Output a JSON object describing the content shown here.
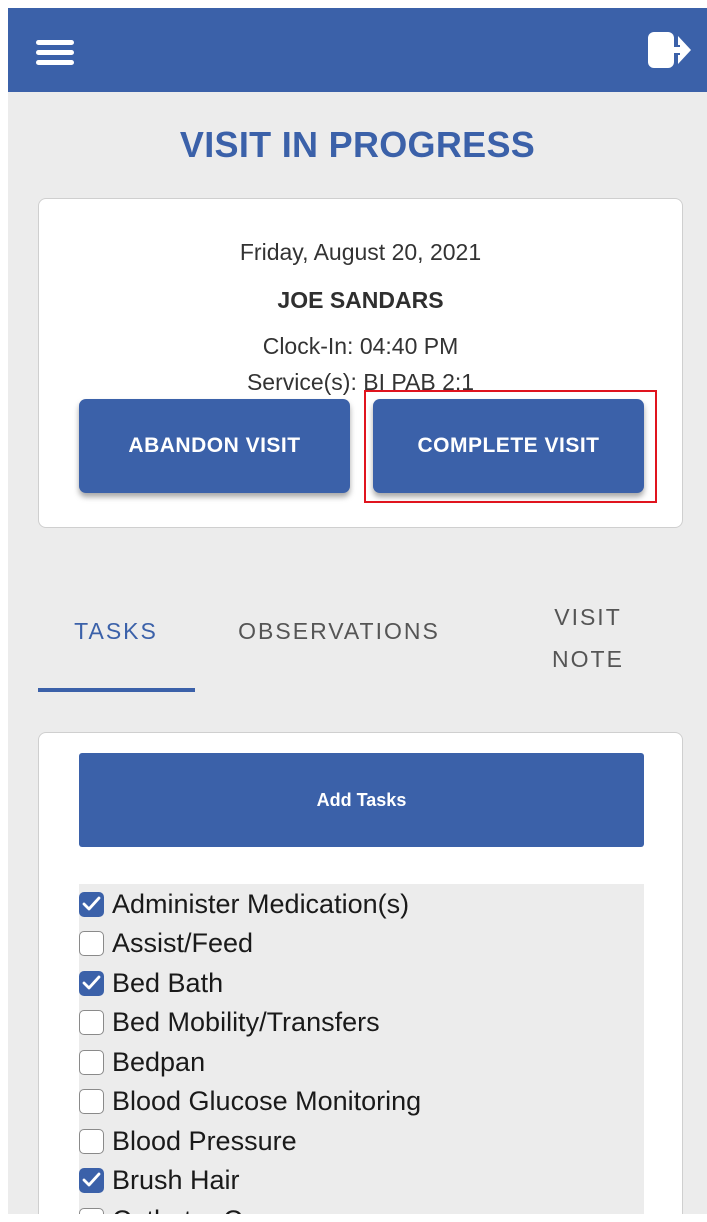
{
  "header": {
    "menu_icon": "hamburger-menu-icon",
    "logout_icon": "logout-icon"
  },
  "page": {
    "title": "VISIT IN PROGRESS"
  },
  "visit": {
    "date": "Friday, August 20, 2021",
    "client_name": "JOE SANDARS",
    "clock_in": "Clock-In: 04:40 PM",
    "services": "Service(s): BI PAB 2:1",
    "abandon_label": "ABANDON VISIT",
    "complete_label": "COMPLETE VISIT"
  },
  "tabs": [
    {
      "label": "TASKS",
      "active": true
    },
    {
      "label": "OBSERVATIONS",
      "active": false
    },
    {
      "label": "VISIT NOTE",
      "active": false
    }
  ],
  "tasks": {
    "add_label": "Add Tasks",
    "items": [
      {
        "label": "Administer Medication(s)",
        "checked": true
      },
      {
        "label": "Assist/Feed",
        "checked": false
      },
      {
        "label": "Bed Bath",
        "checked": true
      },
      {
        "label": "Bed Mobility/Transfers",
        "checked": false
      },
      {
        "label": "Bedpan",
        "checked": false
      },
      {
        "label": "Blood Glucose Monitoring",
        "checked": false
      },
      {
        "label": "Blood Pressure",
        "checked": false
      },
      {
        "label": "Brush Hair",
        "checked": true
      },
      {
        "label": "Catheter Care",
        "checked": false
      }
    ]
  },
  "colors": {
    "primary": "#3b61a9",
    "background": "#ececec",
    "highlight": "#e0141e"
  }
}
